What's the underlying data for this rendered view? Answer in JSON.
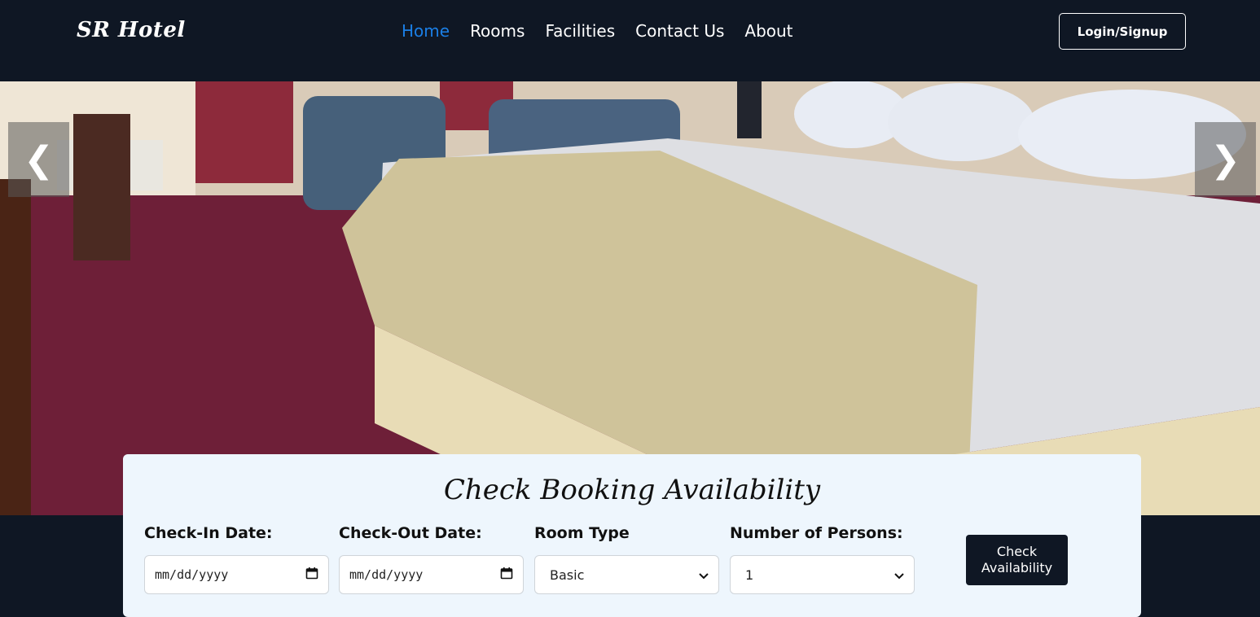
{
  "navbar": {
    "brand": "SR Hotel",
    "links": [
      {
        "label": "Home",
        "active": true
      },
      {
        "label": "Rooms"
      },
      {
        "label": "Facilities"
      },
      {
        "label": "Contact Us"
      },
      {
        "label": "About"
      }
    ],
    "login_label": "Login/Signup"
  },
  "carousel": {
    "prev_icon": "chevron-left-icon",
    "next_icon": "chevron-right-icon",
    "prev_glyph": "❮",
    "next_glyph": "❯",
    "image": "hotel-room-bed-photo"
  },
  "booking": {
    "title": "Check Booking Availability",
    "checkin_label": "Check-In Date:",
    "checkin_placeholder": "mm/dd/yyyy",
    "checkout_label": "Check-Out Date:",
    "checkout_placeholder": "mm/dd/yyyy",
    "room_type_label": "Room Type",
    "room_type_value": "Basic",
    "persons_label": "Number of Persons:",
    "persons_value": "1",
    "submit_label_line1": "Check",
    "submit_label_line2": "Availability"
  },
  "colors": {
    "nav_bg": "#0f1724",
    "active_link": "#1b7fe6",
    "card_bg": "#eef6fd",
    "button_bg": "#0f1724"
  }
}
